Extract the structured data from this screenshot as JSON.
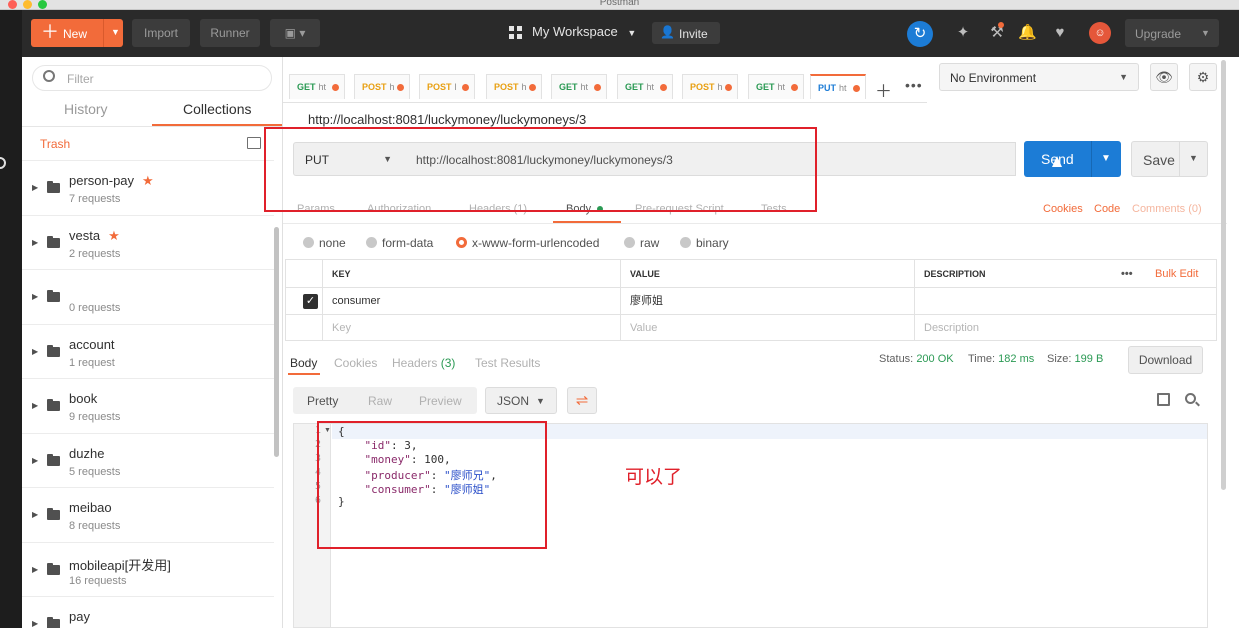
{
  "window_title": "Postman",
  "toolbar": {
    "new_label": "New",
    "import_label": "Import",
    "runner_label": "Runner",
    "workspace": "My Workspace",
    "invite": "Invite",
    "upgrade": "Upgrade"
  },
  "sidebar": {
    "filter_placeholder": "Filter",
    "tabs": [
      "History",
      "Collections"
    ],
    "active_tab": "Collections",
    "trash": "Trash",
    "collections": [
      {
        "name": "person-pay",
        "count": "7 requests",
        "favorite": true
      },
      {
        "name": "vesta",
        "count": "2 requests",
        "favorite": true
      },
      {
        "name": "",
        "count": "0 requests",
        "favorite": false
      },
      {
        "name": "account",
        "count": "1 request",
        "favorite": false
      },
      {
        "name": "book",
        "count": "9 requests",
        "favorite": false
      },
      {
        "name": "duzhe",
        "count": "5 requests",
        "favorite": false
      },
      {
        "name": "meibao",
        "count": "8 requests",
        "favorite": false
      },
      {
        "name": "mobileapi[开发用]",
        "count": "16 requests",
        "favorite": false
      },
      {
        "name": "pay",
        "count": "",
        "favorite": false
      }
    ]
  },
  "tabs": [
    {
      "method": "GET",
      "url": "ht",
      "color": "#2b9a54"
    },
    {
      "method": "POST",
      "url": "h",
      "color": "#e8a013"
    },
    {
      "method": "POST",
      "url": "l",
      "color": "#e8a013"
    },
    {
      "method": "POST",
      "url": "h",
      "color": "#e8a013"
    },
    {
      "method": "GET",
      "url": "ht",
      "color": "#2b9a54"
    },
    {
      "method": "GET",
      "url": "ht",
      "color": "#2b9a54"
    },
    {
      "method": "POST",
      "url": "h",
      "color": "#e8a013"
    },
    {
      "method": "GET",
      "url": "ht",
      "color": "#2b9a54"
    },
    {
      "method": "PUT",
      "url": "ht",
      "color": "#1c7cd6"
    }
  ],
  "environment": "No Environment",
  "request": {
    "title": "http://localhost:8081/luckymoney/luckymoneys/3",
    "method": "PUT",
    "url": "http://localhost:8081/luckymoney/luckymoneys/3",
    "send": "Send",
    "save": "Save"
  },
  "request_tabs": {
    "params": "Params",
    "authorization": "Authorization",
    "headers": "Headers (1)",
    "body": "Body",
    "prerequest": "Pre-request Script",
    "tests": "Tests",
    "cookies": "Cookies",
    "code": "Code",
    "comments": "Comments (0)"
  },
  "body_types": {
    "none": "none",
    "form_data": "form-data",
    "urlencoded": "x-www-form-urlencoded",
    "raw": "raw",
    "binary": "binary"
  },
  "kv_table": {
    "col_key": "KEY",
    "col_value": "VALUE",
    "col_desc": "DESCRIPTION",
    "more": "•••",
    "bulk_edit": "Bulk Edit",
    "row_key": "consumer",
    "row_value": "廖师姐",
    "ph_key": "Key",
    "ph_value": "Value",
    "ph_desc": "Description"
  },
  "response": {
    "tab_body": "Body",
    "tab_cookies": "Cookies",
    "tab_headers": "Headers",
    "tab_headers_count": "(3)",
    "tab_tests": "Test Results",
    "status_label": "Status:",
    "status_value": "200 OK",
    "time_label": "Time:",
    "time_value": "182 ms",
    "size_label": "Size:",
    "size_value": "199 B",
    "download": "Download",
    "view_pretty": "Pretty",
    "view_raw": "Raw",
    "view_preview": "Preview",
    "format": "JSON",
    "line_numbers": [
      "1",
      "2",
      "3",
      "4",
      "5",
      "6"
    ],
    "json": {
      "open": "{",
      "id_key": "\"id\"",
      "id_val": "3,",
      "money_key": "\"money\"",
      "money_val": "100,",
      "producer_key": "\"producer\"",
      "producer_val": "\"廖师兄\"",
      "consumer_key": "\"consumer\"",
      "consumer_val": "\"廖师姐\"",
      "close": "}"
    }
  },
  "annotation": "可以了",
  "colors": {
    "accent": "#f26b3a",
    "send_blue": "#1c7cd6",
    "highlight_red": "#e0202a"
  }
}
